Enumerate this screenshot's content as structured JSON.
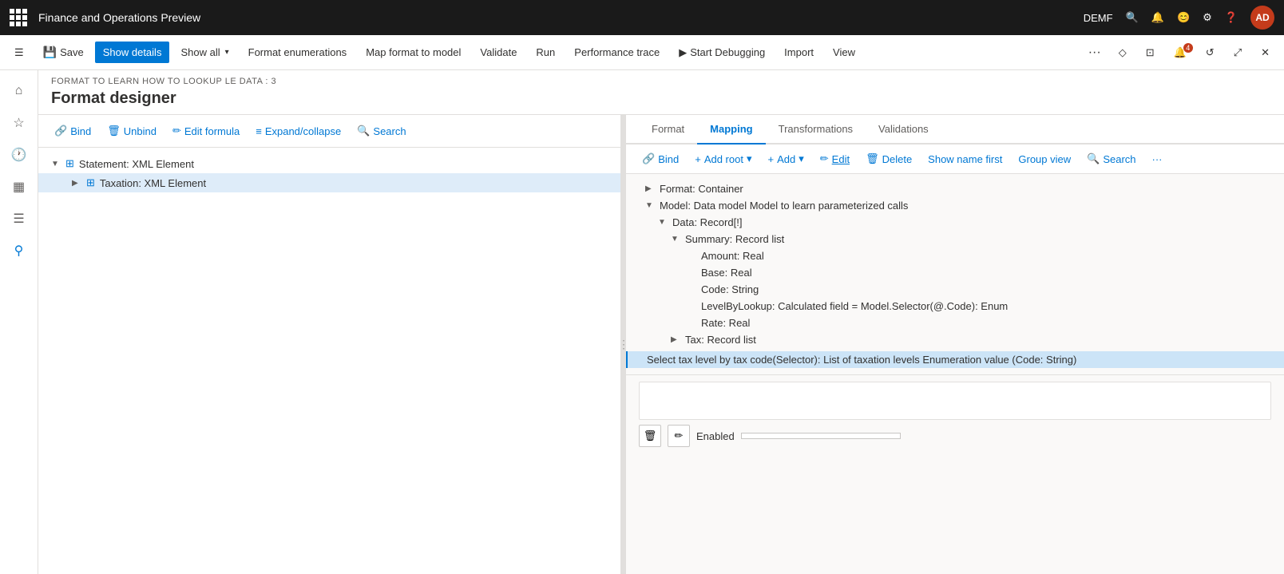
{
  "app": {
    "title": "Finance and Operations Preview",
    "tenant": "DEMF",
    "user_initials": "AD"
  },
  "command_bar": {
    "save_label": "Save",
    "show_details_label": "Show details",
    "show_all_label": "Show all",
    "format_enumerations_label": "Format enumerations",
    "map_format_label": "Map format to model",
    "validate_label": "Validate",
    "run_label": "Run",
    "performance_trace_label": "Performance trace",
    "start_debugging_label": "Start Debugging",
    "import_label": "Import",
    "view_label": "View"
  },
  "page": {
    "subtitle": "FORMAT TO LEARN HOW TO LOOKUP LE DATA : 3",
    "title": "Format designer"
  },
  "left_toolbar": {
    "bind_label": "Bind",
    "unbind_label": "Unbind",
    "edit_formula_label": "Edit formula",
    "expand_collapse_label": "Expand/collapse",
    "search_label": "Search"
  },
  "left_tree": {
    "items": [
      {
        "label": "Statement: XML Element",
        "level": 0,
        "expanded": true,
        "type": "xml"
      },
      {
        "label": "Taxation: XML Element",
        "level": 1,
        "expanded": false,
        "type": "xml",
        "selected": true
      }
    ]
  },
  "tabs": [
    {
      "id": "format",
      "label": "Format"
    },
    {
      "id": "mapping",
      "label": "Mapping",
      "active": true
    },
    {
      "id": "transformations",
      "label": "Transformations"
    },
    {
      "id": "validations",
      "label": "Validations"
    }
  ],
  "right_toolbar": {
    "bind_label": "Bind",
    "add_root_label": "Add root",
    "add_label": "Add",
    "edit_label": "Edit",
    "delete_label": "Delete",
    "show_name_first_label": "Show name first",
    "group_view_label": "Group view",
    "search_label": "Search"
  },
  "right_tree": {
    "items": [
      {
        "label": "Format: Container",
        "level": 0,
        "expanded": false,
        "chevron": "▶"
      },
      {
        "label": "Model: Data model Model to learn parameterized calls",
        "level": 0,
        "expanded": true,
        "chevron": "▼"
      },
      {
        "label": "Data: Record[!]",
        "level": 1,
        "expanded": true,
        "chevron": "▼"
      },
      {
        "label": "Summary: Record list",
        "level": 2,
        "expanded": true,
        "chevron": "▼"
      },
      {
        "label": "Amount: Real",
        "level": 3,
        "expanded": false,
        "chevron": ""
      },
      {
        "label": "Base: Real",
        "level": 3,
        "expanded": false,
        "chevron": ""
      },
      {
        "label": "Code: String",
        "level": 3,
        "expanded": false,
        "chevron": ""
      },
      {
        "label": "LevelByLookup: Calculated field = Model.Selector(@.Code): Enum",
        "level": 3,
        "expanded": false,
        "chevron": ""
      },
      {
        "label": "Rate: Real",
        "level": 3,
        "expanded": false,
        "chevron": ""
      },
      {
        "label": "Tax: Record list",
        "level": 2,
        "expanded": false,
        "chevron": "▶"
      }
    ]
  },
  "selected_formula": {
    "text": "Select tax level by tax code(Selector): List of taxation levels Enumeration value (Code: String)"
  },
  "bottom": {
    "enabled_label": "Enabled",
    "formula_placeholder": "",
    "delete_icon": "🗑",
    "edit_icon": "✏"
  },
  "colors": {
    "primary_blue": "#0078d4",
    "selected_bg": "#cce4f7",
    "formula_selected_bg": "#cce4f7",
    "border": "#e1dfdd"
  }
}
